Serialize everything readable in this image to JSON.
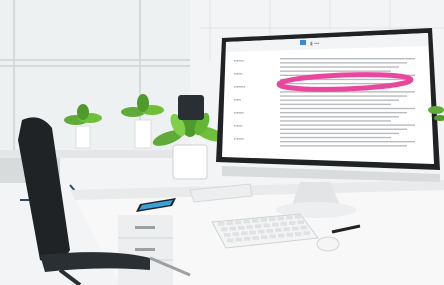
{
  "scene": {
    "alt": "Office desk with a computer monitor showing a web page; a pink highlight marks one line on the screen",
    "colors": {
      "highlight": "#e8479e",
      "screen_bg": "#ffffff",
      "bezel": "#1f2326",
      "desk": "#f7f7f7",
      "plant": "#6fbf3a",
      "phone_screen": "#3aa0d8"
    },
    "icons": [
      "office-chair",
      "monitor",
      "keyboard",
      "mouse",
      "pen",
      "smartphone",
      "plant",
      "window"
    ]
  },
  "screen": {
    "header_text": "▮ ▪▪▪",
    "sidebar_items": [
      "▪▪▪▪▪▪▪",
      "▪▪▪▪▪▪",
      "▪▪▪▪▪▪▪▪",
      "▪▪▪▪▪",
      "▪▪▪▪▪▪▪",
      "▪▪▪▪▪▪",
      "▪▪▪▪▪▪▪"
    ]
  }
}
